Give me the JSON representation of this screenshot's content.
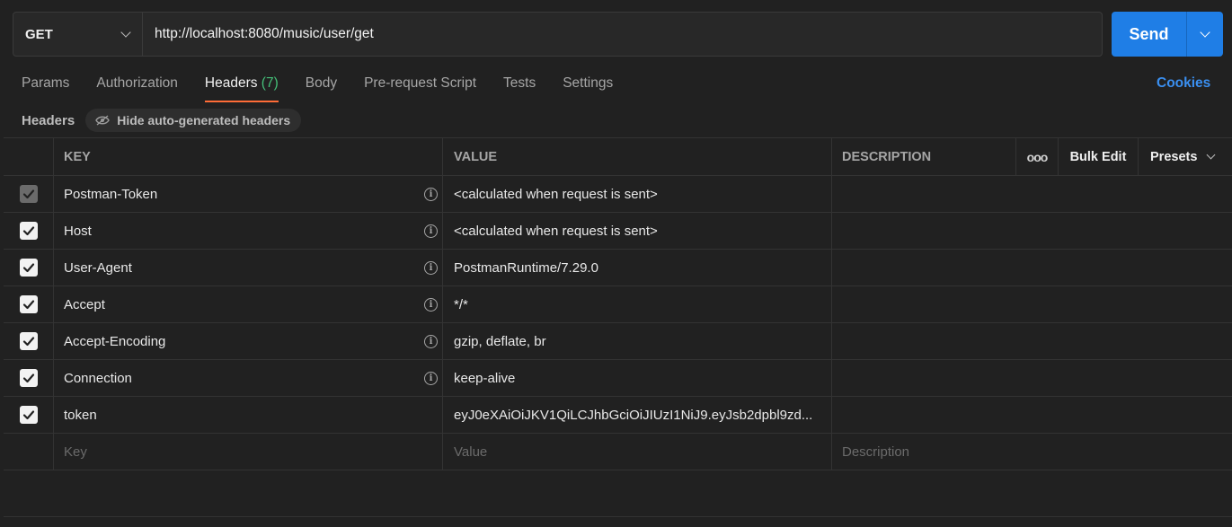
{
  "request": {
    "method": "GET",
    "url": "http://localhost:8080/music/user/get",
    "send_label": "Send"
  },
  "tabs": [
    {
      "label": "Params"
    },
    {
      "label": "Authorization"
    },
    {
      "label": "Headers",
      "count": "(7)"
    },
    {
      "label": "Body"
    },
    {
      "label": "Pre-request Script"
    },
    {
      "label": "Tests"
    },
    {
      "label": "Settings"
    }
  ],
  "cookies_label": "Cookies",
  "subheader": {
    "title": "Headers",
    "toggle_label": "Hide auto-generated headers"
  },
  "table": {
    "columns": {
      "key": "KEY",
      "value": "VALUE",
      "description": "DESCRIPTION",
      "more": "ooo",
      "bulk_edit": "Bulk Edit",
      "presets": "Presets"
    },
    "rows": [
      {
        "key": "Postman-Token",
        "value": "<calculated when request is sent>",
        "checked": true,
        "disabled": true,
        "info": true
      },
      {
        "key": "Host",
        "value": "<calculated when request is sent>",
        "checked": true,
        "disabled": false,
        "info": true
      },
      {
        "key": "User-Agent",
        "value": "PostmanRuntime/7.29.0",
        "checked": true,
        "disabled": false,
        "info": true
      },
      {
        "key": "Accept",
        "value": "*/*",
        "checked": true,
        "disabled": false,
        "info": true
      },
      {
        "key": "Accept-Encoding",
        "value": "gzip, deflate, br",
        "checked": true,
        "disabled": false,
        "info": true
      },
      {
        "key": "Connection",
        "value": "keep-alive",
        "checked": true,
        "disabled": false,
        "info": true
      },
      {
        "key": "token",
        "value": "eyJ0eXAiOiJKV1QiLCJhbGciOiJIUzI1NiJ9.eyJsb2dpbl9zd...",
        "checked": true,
        "disabled": false,
        "info": false
      }
    ],
    "placeholders": {
      "key": "Key",
      "value": "Value",
      "description": "Description"
    }
  },
  "colors": {
    "accent": "#1f7ee6",
    "active_tab": "#ff6c37",
    "count": "#45c079",
    "link": "#3a8ff0"
  }
}
